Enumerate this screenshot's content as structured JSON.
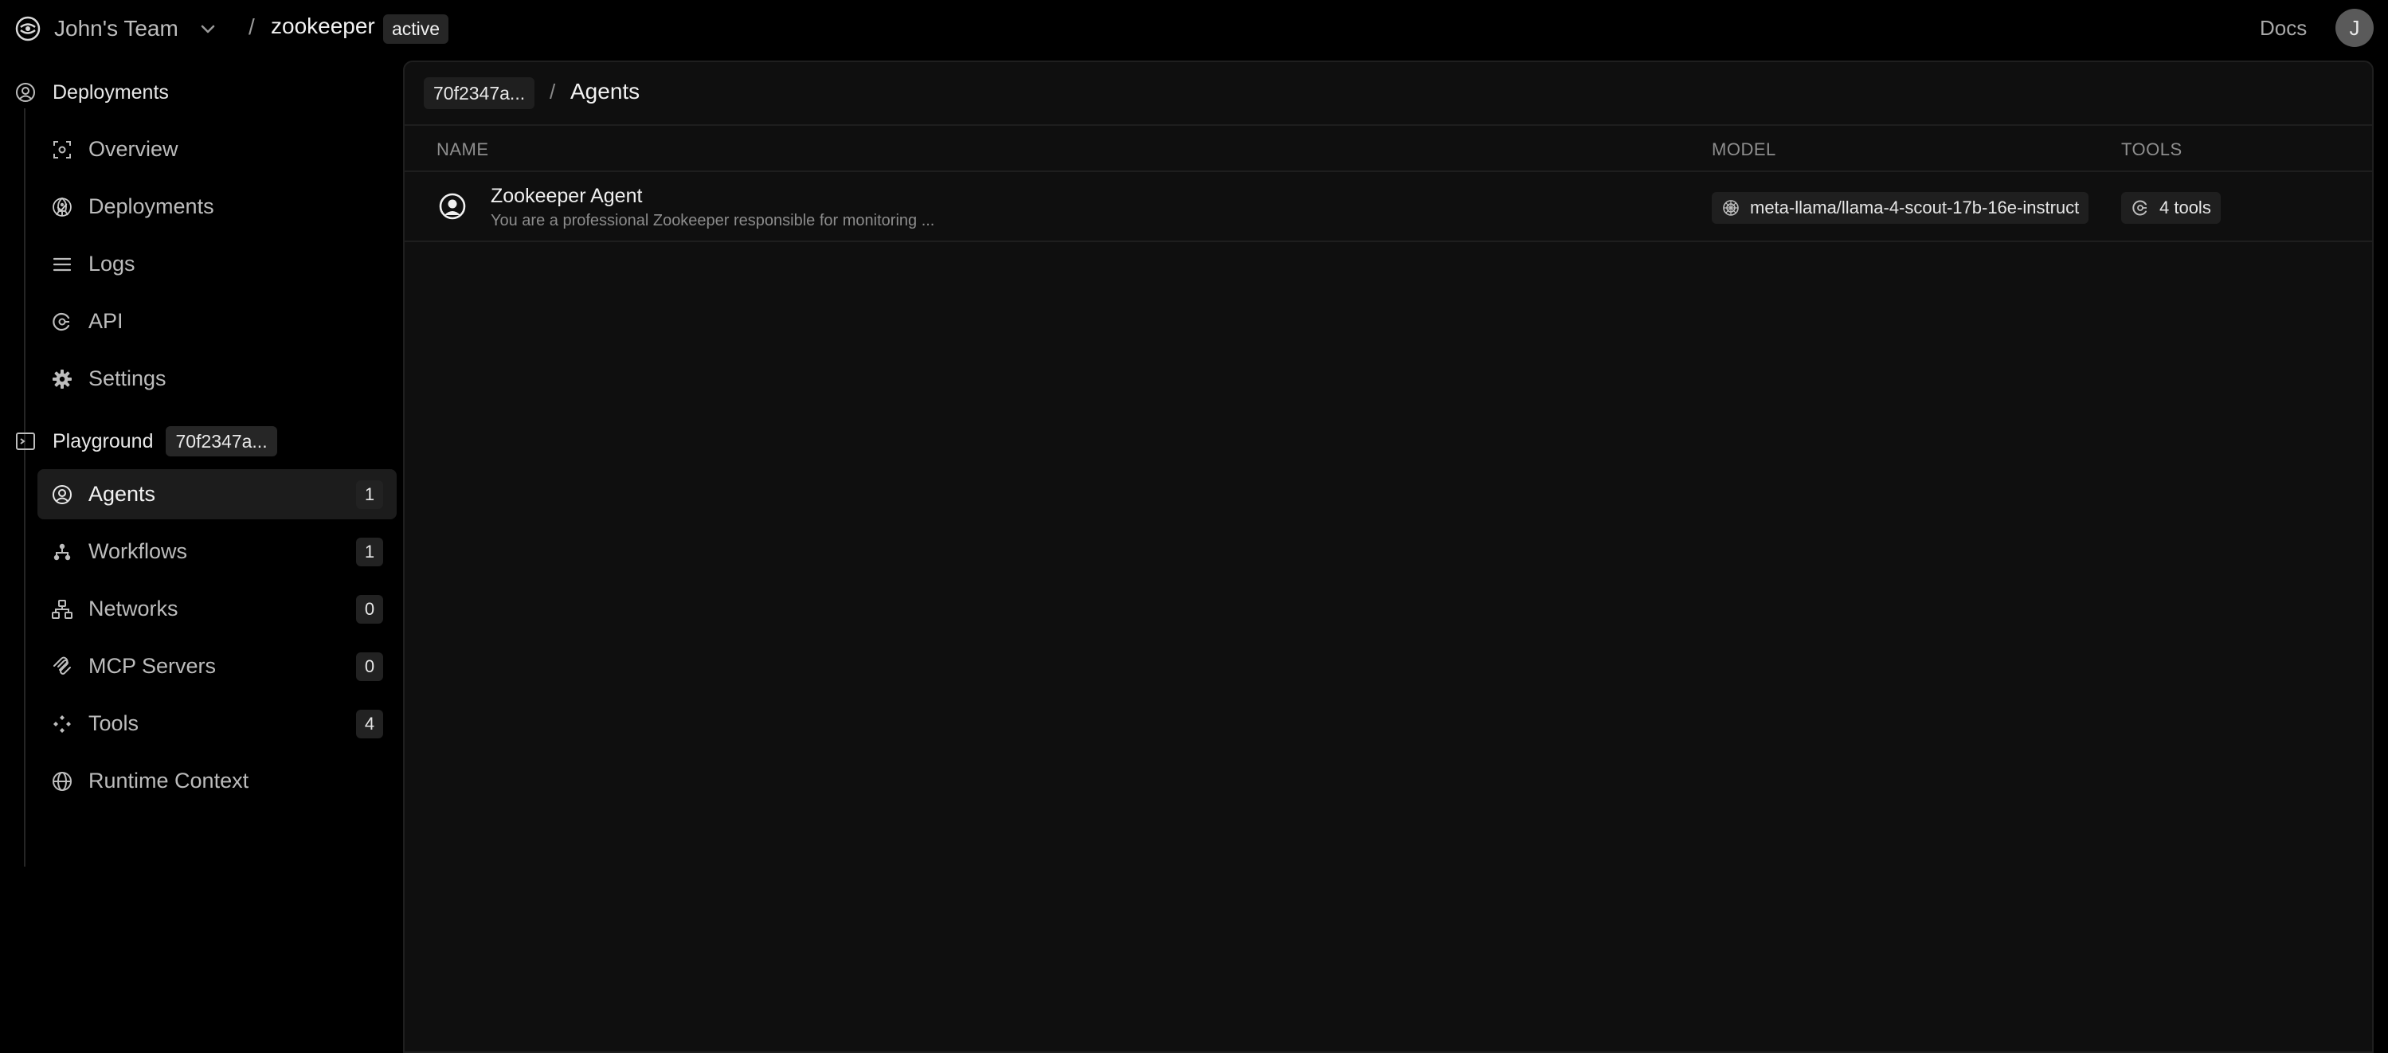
{
  "topbar": {
    "team_name": "John's Team",
    "separator": "/",
    "project_name": "zookeeper",
    "status_badge": "active",
    "docs_link": "Docs",
    "avatar_initial": "J"
  },
  "sidebar": {
    "deployments_section": {
      "title": "Deployments",
      "items": [
        {
          "label": "Overview",
          "icon": "overview-icon"
        },
        {
          "label": "Deployments",
          "icon": "rocket-icon",
          "status": "check-circle-icon"
        },
        {
          "label": "Logs",
          "icon": "list-icon"
        },
        {
          "label": "API",
          "icon": "api-icon"
        },
        {
          "label": "Settings",
          "icon": "gear-icon"
        }
      ]
    },
    "playground_section": {
      "title": "Playground",
      "hash": "70f2347a...",
      "items": [
        {
          "label": "Agents",
          "count": "1",
          "icon": "agent-icon",
          "active": true
        },
        {
          "label": "Workflows",
          "count": "1",
          "icon": "workflow-icon"
        },
        {
          "label": "Networks",
          "count": "0",
          "icon": "network-icon"
        },
        {
          "label": "MCP Servers",
          "count": "0",
          "icon": "mcp-icon"
        },
        {
          "label": "Tools",
          "count": "4",
          "icon": "tools-icon"
        },
        {
          "label": "Runtime Context",
          "icon": "globe-icon"
        }
      ]
    }
  },
  "main": {
    "breadcrumb_hash": "70f2347a...",
    "breadcrumb_sep": "/",
    "title": "Agents",
    "table": {
      "columns": [
        "NAME",
        "MODEL",
        "TOOLS"
      ],
      "rows": [
        {
          "name": "Zookeeper Agent",
          "description": "You are a professional Zookeeper responsible for monitoring ...",
          "model": "meta-llama/llama-4-scout-17b-16e-instruct",
          "tools": "4 tools"
        }
      ]
    }
  },
  "colors": {
    "background": "#000000",
    "panel": "#0f0f0f",
    "active_item": "#1c1c1c",
    "chip": "#1f1f1f"
  }
}
